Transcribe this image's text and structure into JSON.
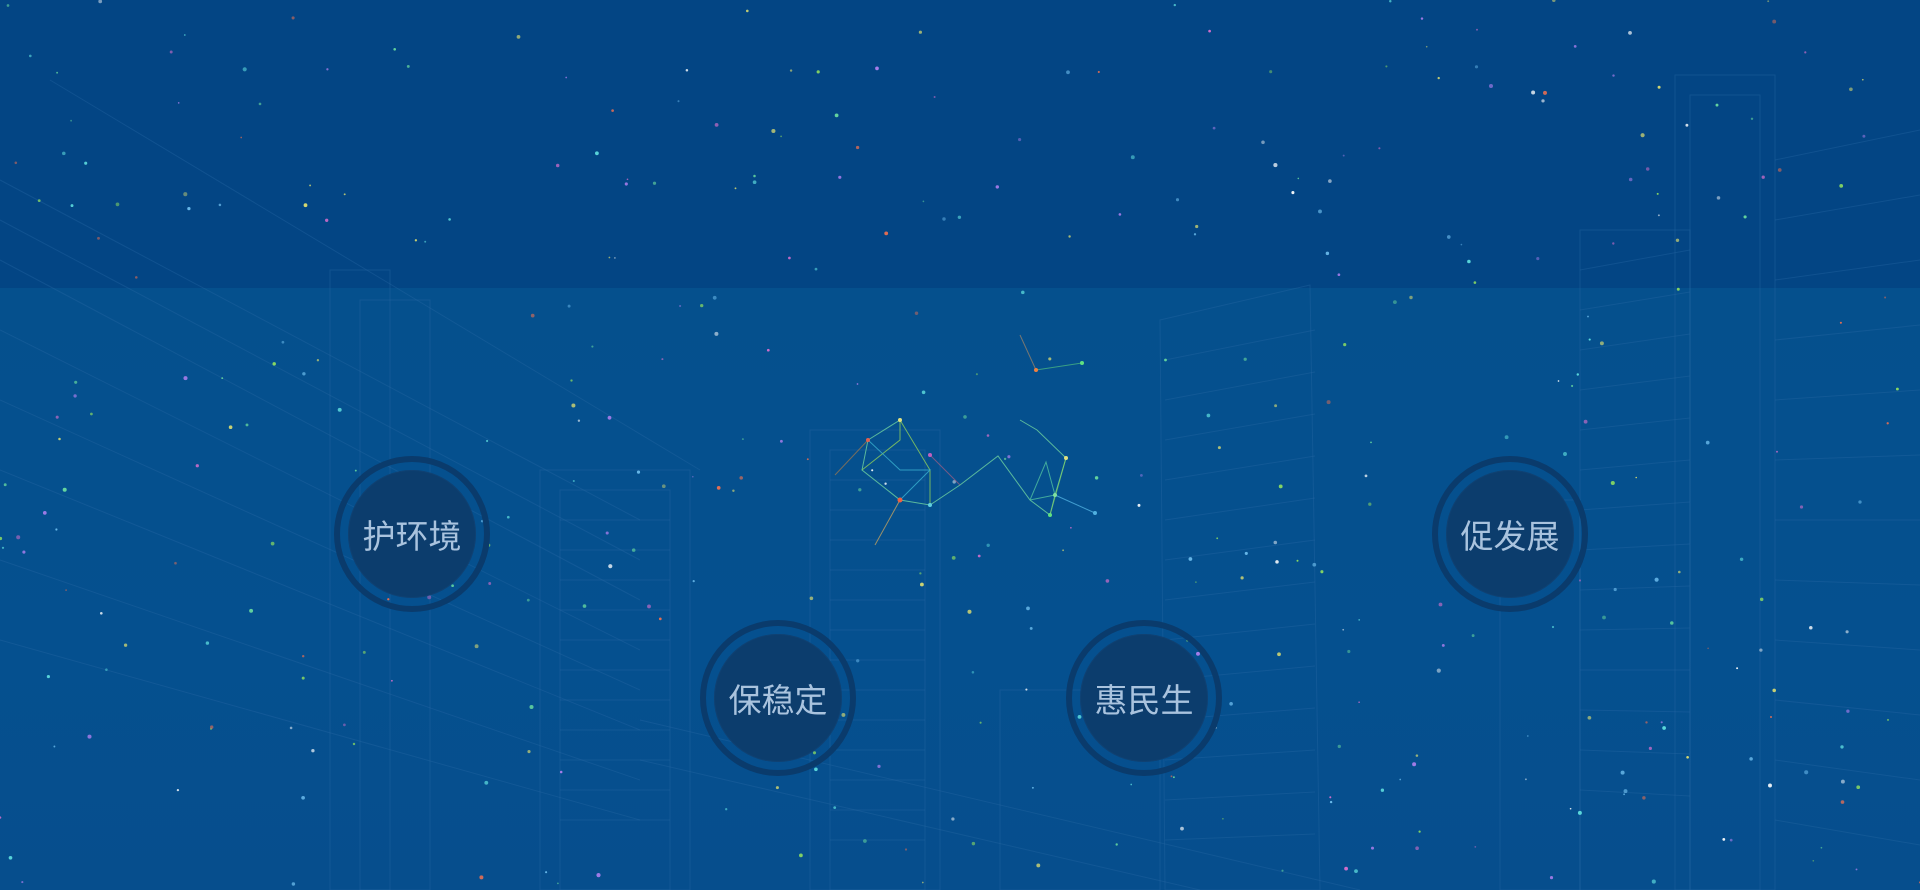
{
  "nav_buttons": [
    {
      "label": "护环境",
      "icon": "circle-badge"
    },
    {
      "label": "保稳定",
      "icon": "circle-badge"
    },
    {
      "label": "惠民生",
      "icon": "circle-badge"
    },
    {
      "label": "促发展",
      "icon": "circle-badge"
    }
  ],
  "colors": {
    "background_top": "#034584",
    "background_lower": "#05508d",
    "circle_fill": "#0c3d6d",
    "circle_ring": "#0a3b6c",
    "label_text": "#a9c3de"
  }
}
